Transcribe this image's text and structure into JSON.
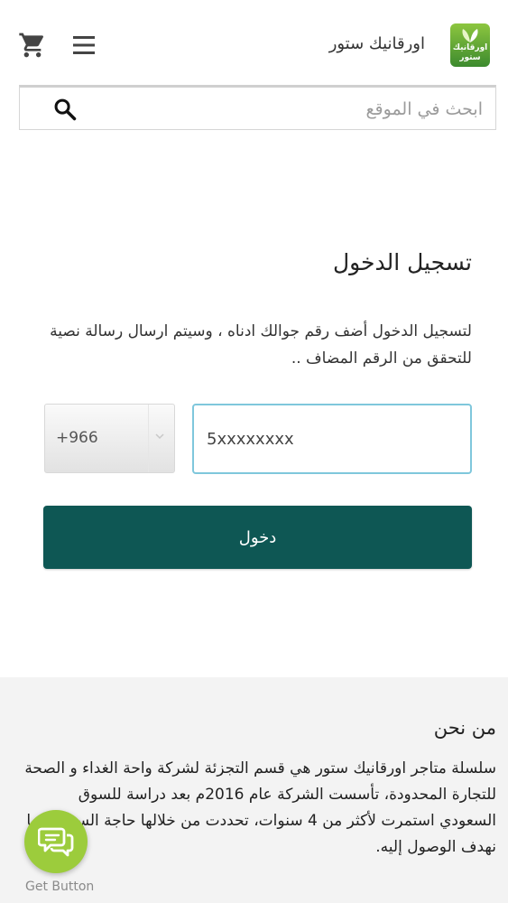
{
  "header": {
    "brand_name": "اورقانيك ستور",
    "logo_text_line1": "اورقانيك",
    "logo_text_line2": "ستور"
  },
  "icons": {
    "cart": "cart-icon",
    "menu": "hamburger-menu-icon",
    "search": "search-icon",
    "chat": "chat-bubbles-icon",
    "dropdown": "chevron-down-icon"
  },
  "search": {
    "placeholder": "ابحث في الموقع"
  },
  "login": {
    "title": "تسجيل الدخول",
    "description": "لتسجيل الدخول أضف رقم جوالك ادناه ، وسيتم ارسال رسالة نصية للتحقق من الرقم المضاف ..",
    "country_code": "+966",
    "phone_placeholder": "5xxxxxxxx",
    "submit_label": "دخول"
  },
  "about": {
    "title": "من نحن",
    "text": "سلسلة متاجر اورقانيك ستور هي قسم التجزئة لشركة واحة الغداء و الصحة للتجارة المحدودة، تأسست الشركة عام 2016م بعد دراسة للسوق السعودي استمرت لأكثر من 4 سنوات، تحددت من خلالها حاجة السوق و ما نهدف الوصول إليه."
  },
  "chat_widget": {
    "label": "Get Button"
  },
  "colors": {
    "primary_button": "#0e5754",
    "input_focus_border": "#7fc7dc",
    "chat_button": "#9ccc3c",
    "footer_bg": "#f3f3f3"
  }
}
